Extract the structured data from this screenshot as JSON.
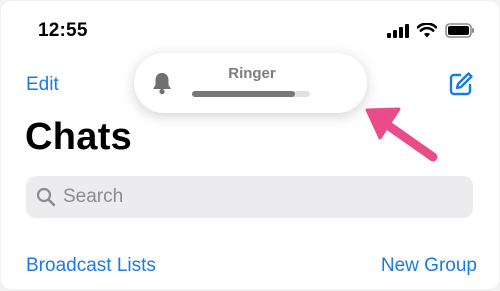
{
  "status_bar": {
    "time": "12:55",
    "icons": [
      "cellular-signal-icon",
      "wifi-icon",
      "battery-icon"
    ]
  },
  "nav": {
    "edit_label": "Edit",
    "compose_icon": "compose-icon"
  },
  "page_title": "Chats",
  "search": {
    "placeholder": "Search",
    "icon": "search-icon"
  },
  "links": {
    "broadcast_lists": "Broadcast Lists",
    "new_group": "New Group"
  },
  "ringer_hud": {
    "label": "Ringer",
    "icon": "bell-icon",
    "level_percent": 87
  },
  "annotation": {
    "icon": "arrow-icon",
    "color": "#ea4c89"
  },
  "colors": {
    "accent": "#1b7ae8",
    "annotation": "#ea4c89"
  }
}
